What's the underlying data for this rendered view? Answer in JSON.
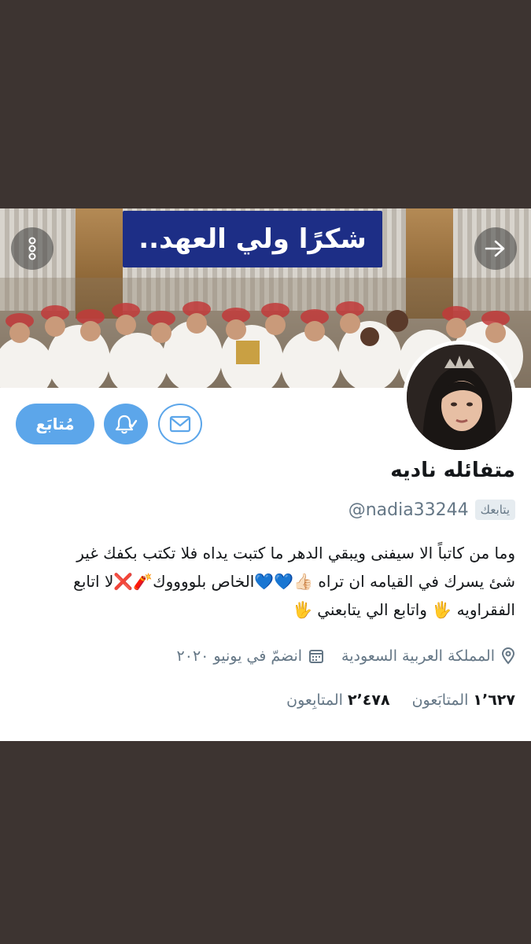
{
  "banner": {
    "headline": "شكرًا ولي العهد..",
    "more_icon": "more-vertical-icon",
    "next_icon": "arrow-right-icon"
  },
  "profile": {
    "display_name": "متفائله ناديه",
    "handle": "@nadia33244",
    "follows_you": "يتابعك",
    "bio_lines": [
      "وما من كاتباً الا سيفنى ويبقي الدهر ما كتبت يداه فلا تكتب بكفك غير",
      "شئ يسرك في القيامه ان تراه 👍🏻💙💙الخاص بلووووك🧨❌لا اتابع",
      "الفقراويه 🖐 واتابع الي يتابعني 🖐"
    ],
    "location": "المملكة العربية السعودية",
    "joined": "انضمّ في يونيو ٢٠٢٠"
  },
  "actions": {
    "follow_label": "مُتابَع",
    "bell_icon": "bell-check-icon",
    "mail_icon": "mail-icon"
  },
  "stats": {
    "following_count": "١٬٦٢٧",
    "following_label": "المتابَعون",
    "followers_count": "٢٬٤٧٨",
    "followers_label": "المتابِعون"
  },
  "colors": {
    "accent": "#5ca6ea",
    "background": "#3d3431",
    "headline_box": "#1d2e86",
    "muted_text": "#657786"
  }
}
